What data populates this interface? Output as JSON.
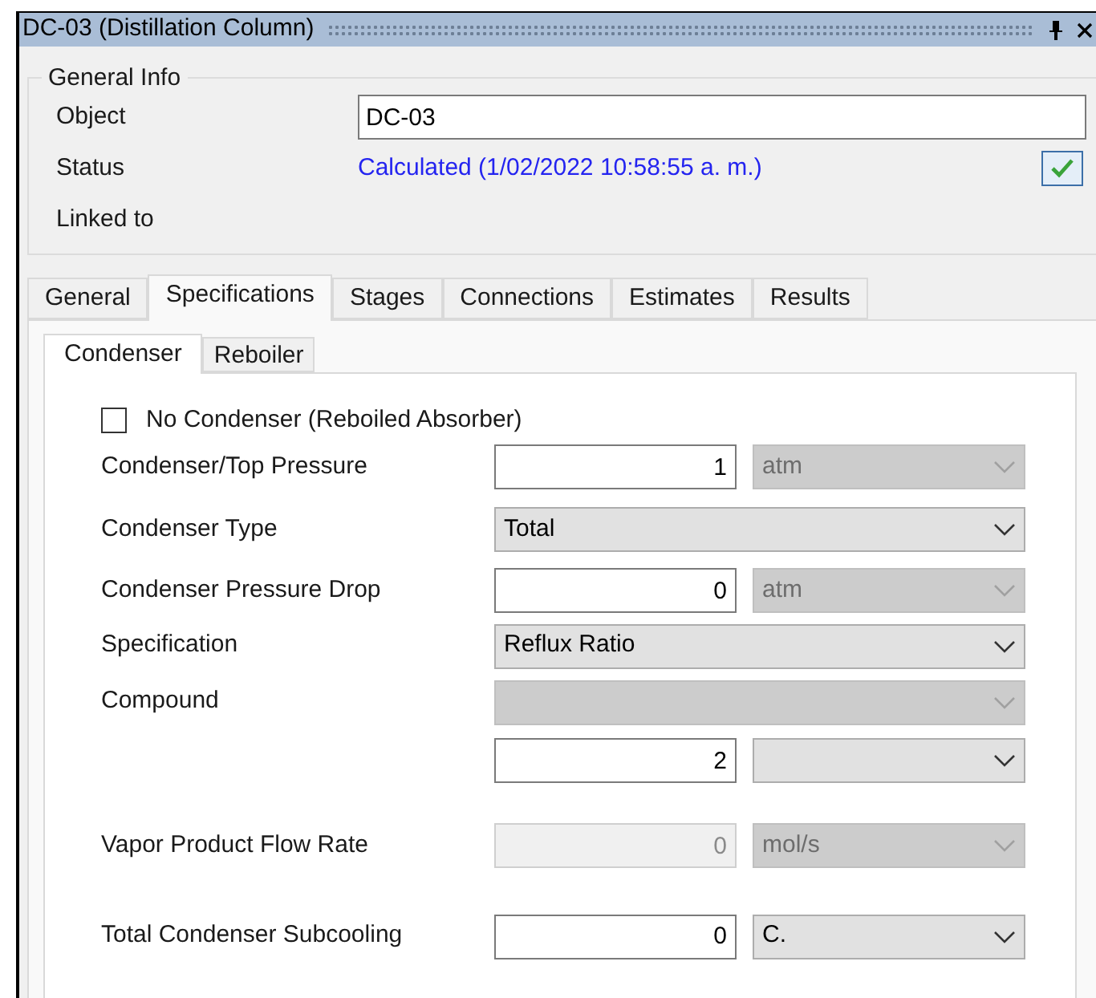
{
  "window": {
    "title": "DC-03 (Distillation Column)"
  },
  "general_info": {
    "title": "General Info",
    "fields": [
      {
        "kind": "input",
        "label": "Object",
        "value": "DC-03"
      },
      {
        "kind": "status",
        "label": "Status",
        "value": "Calculated (1/02/2022 10:58:55 a. m.)",
        "ok": true
      },
      {
        "kind": "empty",
        "label": "Linked to"
      }
    ]
  },
  "tabs": [
    {
      "label": "General",
      "selected": false
    },
    {
      "label": "Specifications",
      "selected": true
    },
    {
      "label": "Stages",
      "selected": false
    },
    {
      "label": "Connections",
      "selected": false
    },
    {
      "label": "Estimates",
      "selected": false
    },
    {
      "label": "Results",
      "selected": false
    }
  ],
  "subtabs": [
    {
      "label": "Condenser",
      "selected": true
    },
    {
      "label": "Reboiler",
      "selected": false
    }
  ],
  "rows": [
    {
      "kind": "checkbox",
      "label": "No Condenser (Reboiled Absorber)",
      "checked": false
    },
    {
      "kind": "value_unit",
      "label": "Condenser/Top Pressure",
      "value": "1",
      "value_disabled": false,
      "unit": "atm",
      "unit_disabled": true
    },
    {
      "kind": "select",
      "label": "Condenser Type",
      "value": "Total",
      "disabled": false
    },
    {
      "kind": "value_unit",
      "label": "Condenser Pressure Drop",
      "value": "0",
      "value_disabled": false,
      "unit": "atm",
      "unit_disabled": true
    },
    {
      "kind": "select",
      "label": "Specification",
      "value": "Reflux Ratio",
      "disabled": false
    },
    {
      "kind": "select",
      "label": "Compound",
      "disabled": true
    },
    {
      "kind": "value_unit",
      "value": "2",
      "value_disabled": false,
      "unit_disabled": false
    },
    {
      "kind": "value_unit",
      "label": "Vapor Product Flow Rate",
      "value": "0",
      "value_disabled": true,
      "unit": "mol/s",
      "unit_disabled": true
    },
    {
      "kind": "value_unit",
      "label": "Total Condenser Subcooling",
      "value": "0",
      "value_disabled": false,
      "unit": "C.",
      "unit_disabled": false
    }
  ]
}
